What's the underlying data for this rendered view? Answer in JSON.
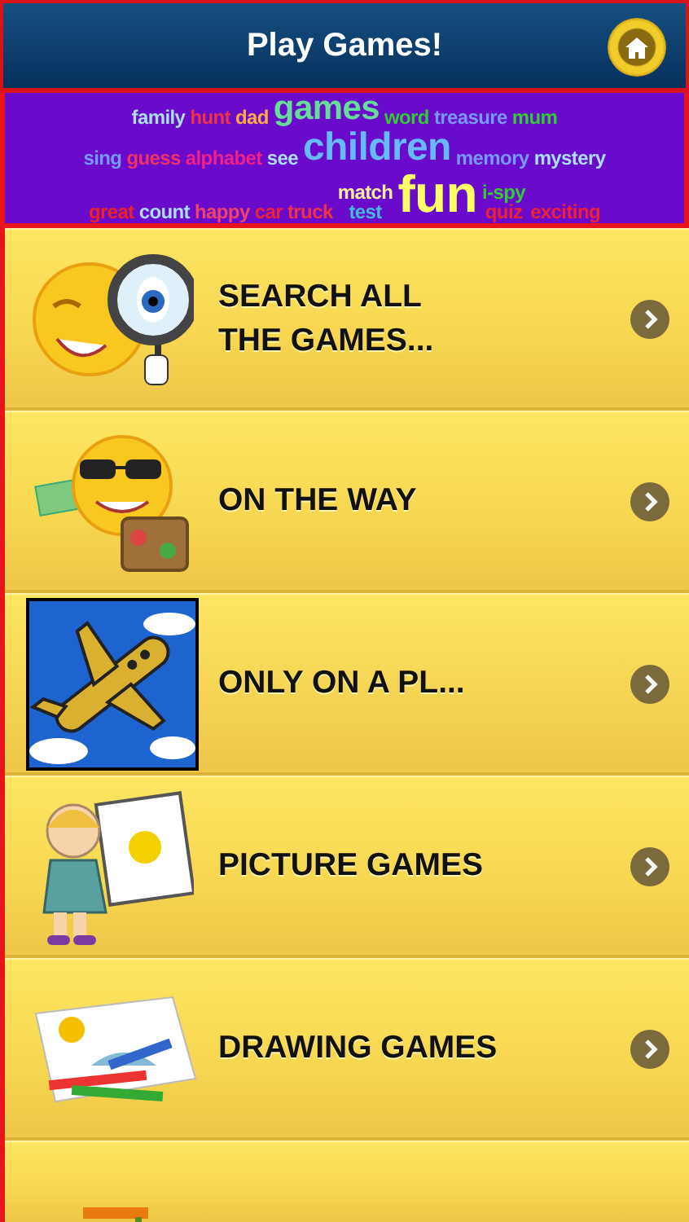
{
  "header": {
    "title": "Play Games!"
  },
  "banner": {
    "words": [
      {
        "text": "family",
        "color": "#aaddee"
      },
      {
        "text": "hunt",
        "color": "#ee3344"
      },
      {
        "text": "dad",
        "color": "#ffaa44"
      },
      {
        "text": "games",
        "color": "#66dd99"
      },
      {
        "text": "word",
        "color": "#33cc33"
      },
      {
        "text": "treasure",
        "color": "#7799ff"
      },
      {
        "text": "mum",
        "color": "#33cc33"
      },
      {
        "text": "sing",
        "color": "#7799ff"
      },
      {
        "text": "guess",
        "color": "#ee3366"
      },
      {
        "text": "alphabet",
        "color": "#ee2288"
      },
      {
        "text": "see",
        "color": "#aaddff"
      },
      {
        "text": "children",
        "color": "#66bbff"
      },
      {
        "text": "memory",
        "color": "#7799ff"
      },
      {
        "text": "mystery",
        "color": "#aaddff"
      },
      {
        "text": "great",
        "color": "#ee2222"
      },
      {
        "text": "count",
        "color": "#aaddff"
      },
      {
        "text": "happy",
        "color": "#ee4466"
      },
      {
        "text": "car",
        "color": "#ee2233"
      },
      {
        "text": "truck",
        "color": "#ee3344"
      },
      {
        "text": "match",
        "color": "#ffee99"
      },
      {
        "text": "test",
        "color": "#44bbdd"
      },
      {
        "text": "fun",
        "color": "#ffff66"
      },
      {
        "text": "i-spy",
        "color": "#33cc33"
      },
      {
        "text": "quiz",
        "color": "#ee2233"
      },
      {
        "text": "exciting",
        "color": "#ee2233"
      }
    ]
  },
  "items": [
    {
      "kind": "magnifier",
      "label": "SEARCH ALL\nTHE GAMES..."
    },
    {
      "kind": "travel",
      "label": "ON THE WAY"
    },
    {
      "kind": "plane",
      "label": "ONLY ON A PL..."
    },
    {
      "kind": "artist",
      "label": "PICTURE GAMES"
    },
    {
      "kind": "drawing",
      "label": "DRAWING GAMES"
    },
    {
      "kind": "wordcloud"
    }
  ]
}
